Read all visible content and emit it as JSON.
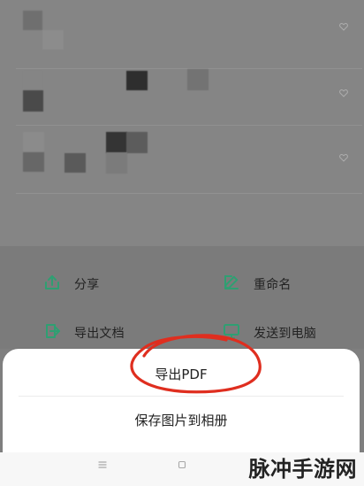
{
  "actions": {
    "share": {
      "label": "分享",
      "icon": "share-icon"
    },
    "rename": {
      "label": "重命名",
      "icon": "edit-icon"
    },
    "export_doc": {
      "label": "导出文档",
      "icon": "export-doc-icon"
    },
    "send_to_pc": {
      "label": "发送到电脑",
      "icon": "monitor-icon"
    }
  },
  "sheet": {
    "export_pdf": {
      "label": "导出PDF"
    },
    "save_album": {
      "label": "保存图片到相册"
    }
  },
  "nav": {
    "menu_icon": "menu-icon",
    "home_icon": "home-icon"
  },
  "watermark": {
    "text": "脉冲手游网"
  },
  "colors": {
    "accent": "#2f9f72",
    "annotation": "#df2e1f",
    "overlay": "#7f7f7f",
    "sheet": "#ffffff"
  }
}
